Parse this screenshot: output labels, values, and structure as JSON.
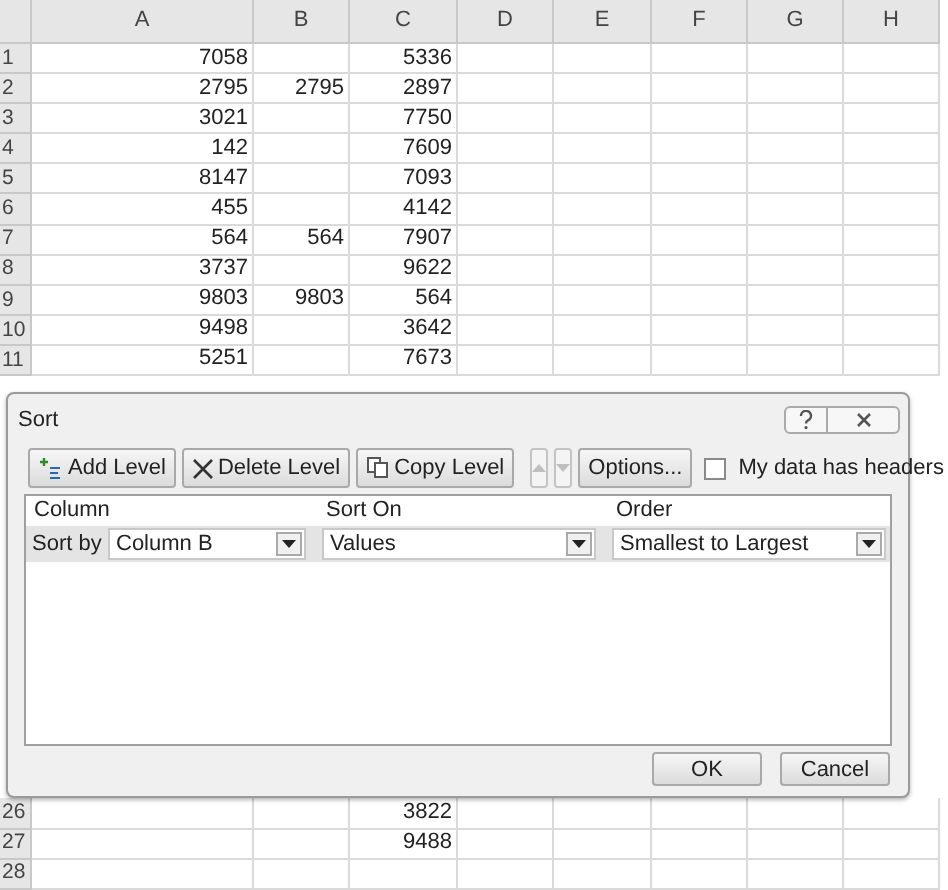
{
  "sheet": {
    "columns": [
      "A",
      "B",
      "C",
      "D",
      "E",
      "F",
      "G",
      "H"
    ],
    "rows_top": [
      {
        "number": "1",
        "cells": [
          "7058",
          "",
          "5336"
        ]
      },
      {
        "number": "2",
        "cells": [
          "2795",
          "2795",
          "2897"
        ]
      },
      {
        "number": "3",
        "cells": [
          "3021",
          "",
          "7750"
        ]
      },
      {
        "number": "4",
        "cells": [
          "142",
          "",
          "7609"
        ]
      },
      {
        "number": "5",
        "cells": [
          "8147",
          "",
          "7093"
        ]
      },
      {
        "number": "6",
        "cells": [
          "455",
          "",
          "4142"
        ]
      },
      {
        "number": "7",
        "cells": [
          "564",
          "564",
          "7907"
        ]
      },
      {
        "number": "8",
        "cells": [
          "3737",
          "",
          "9622"
        ]
      },
      {
        "number": "9",
        "cells": [
          "9803",
          "9803",
          "564"
        ]
      },
      {
        "number": "10",
        "cells": [
          "9498",
          "",
          "3642"
        ]
      },
      {
        "number": "11",
        "cells": [
          "5251",
          "",
          "7673"
        ]
      }
    ],
    "rows_bottom": [
      {
        "number": "26",
        "cells": [
          "",
          "",
          "3822"
        ]
      },
      {
        "number": "27",
        "cells": [
          "",
          "",
          "9488"
        ]
      },
      {
        "number": "28",
        "cells": [
          "",
          "",
          ""
        ]
      }
    ]
  },
  "dialog": {
    "title": "Sort",
    "toolbar": [
      {
        "kind": "button",
        "label": "Add Level"
      },
      {
        "kind": "button",
        "label": "Delete Level"
      },
      {
        "kind": "button",
        "label": "Copy Level"
      },
      {
        "kind": "up",
        "disabled": true
      },
      {
        "kind": "down",
        "disabled": true
      },
      {
        "kind": "button",
        "label": "Options..."
      }
    ],
    "headers_checkbox": {
      "label": "My data has headers",
      "checked": false
    },
    "columns": [
      "Column",
      "Sort On",
      "Order"
    ],
    "levels": [
      {
        "label": "Sort by",
        "column": "Column B",
        "sort_on": "Values",
        "order": "Smallest to Largest",
        "selected": true
      }
    ],
    "buttons": [
      "OK",
      "Cancel"
    ]
  }
}
